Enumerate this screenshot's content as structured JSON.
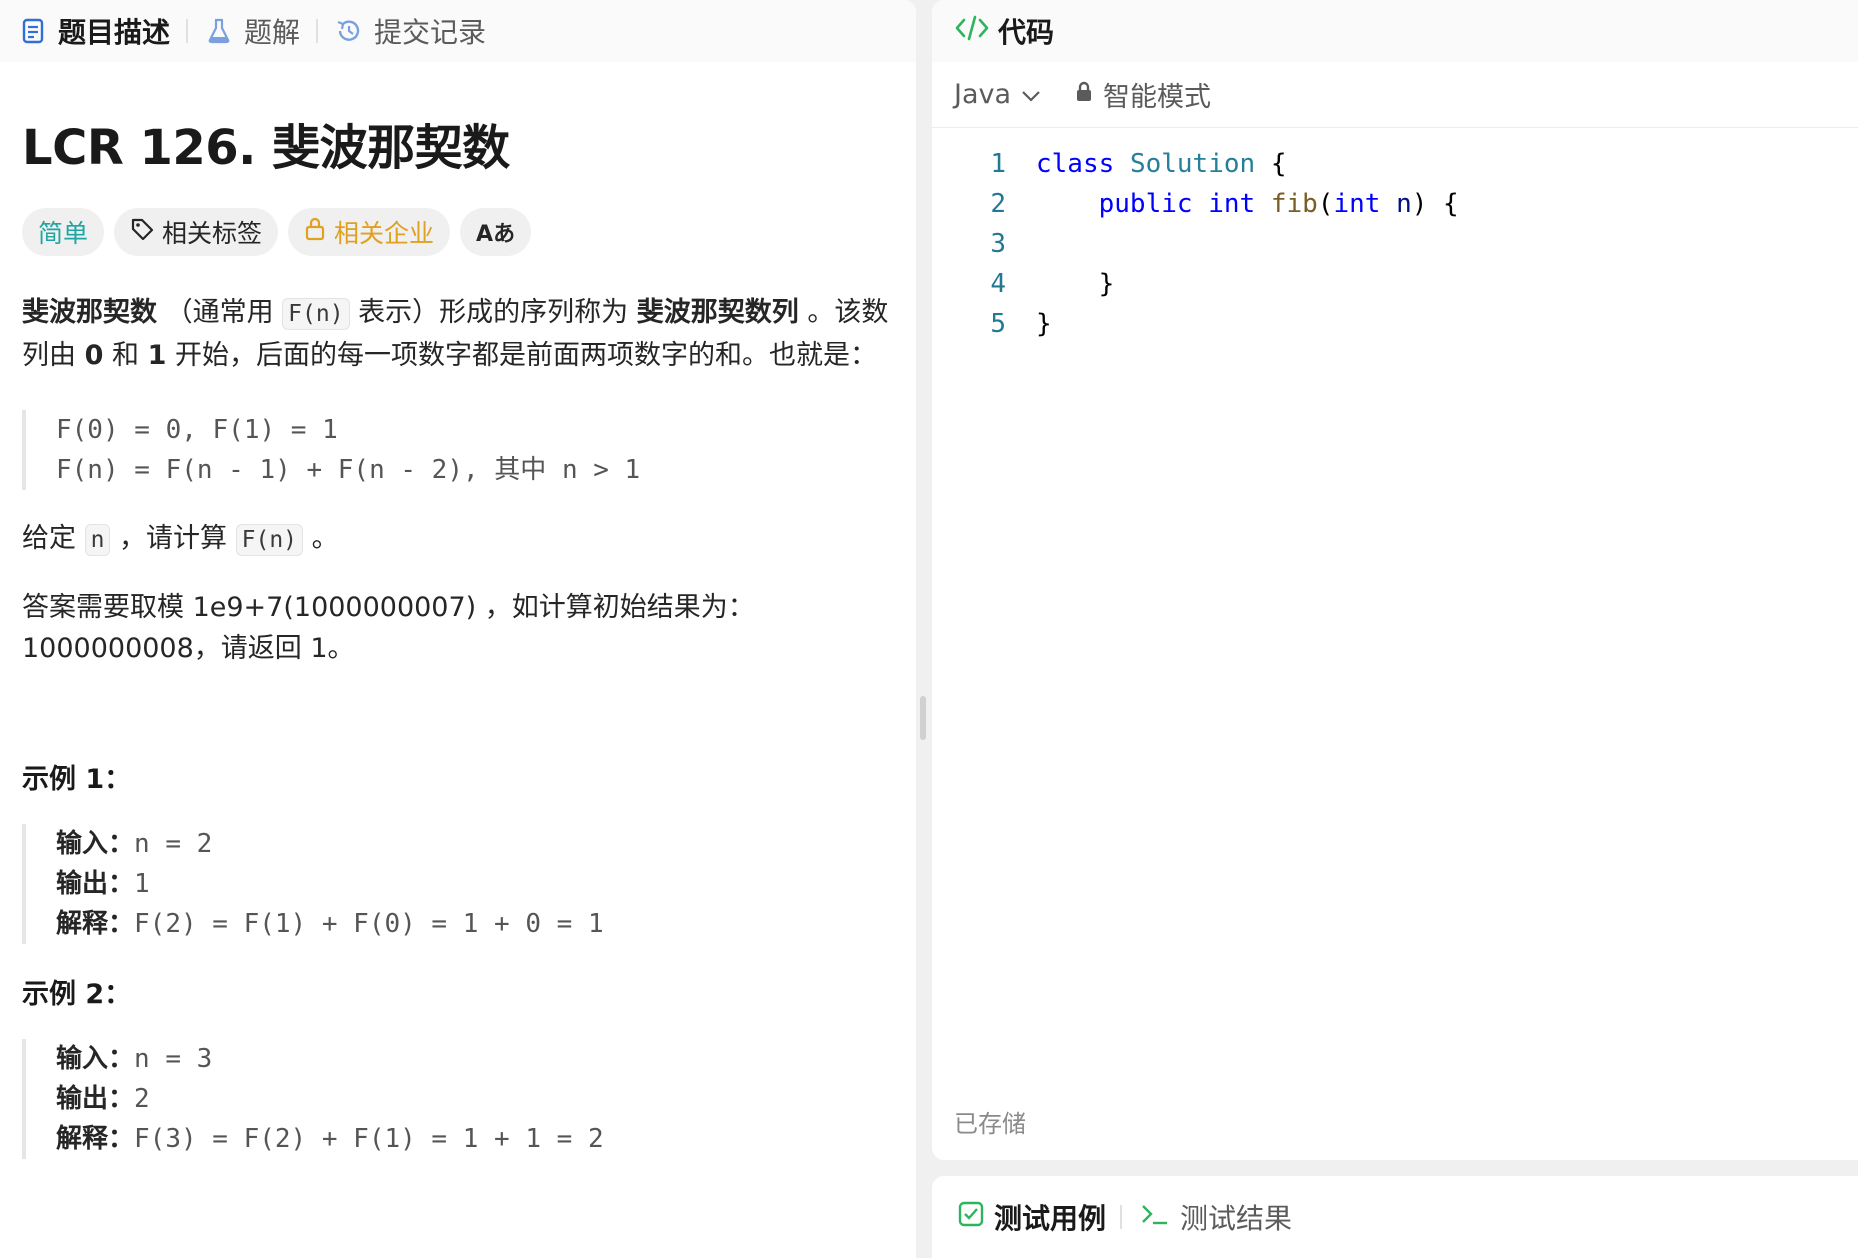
{
  "left_tabs": [
    {
      "label": "题目描述",
      "icon": "description-icon",
      "active": true
    },
    {
      "label": "题解",
      "icon": "flask-icon",
      "active": false
    },
    {
      "label": "提交记录",
      "icon": "history-icon",
      "active": false
    }
  ],
  "problem": {
    "title": "LCR 126. 斐波那契数",
    "tags": {
      "difficulty": "简单",
      "related_tags": "相关标签",
      "related_companies": "相关企业",
      "translate_icon": "Aあ"
    },
    "desc": {
      "b1": "斐波那契数",
      "t1": " （通常用 ",
      "c1": "F(n)",
      "t2": " 表示）形成的序列称为 ",
      "b2": "斐波那契数列",
      "t3": " 。该数列由 ",
      "b3": "0",
      "t4": " 和 ",
      "b4": "1",
      "t5": " 开始，后面的每一项数字都是前面两项数字的和。也就是："
    },
    "formula": [
      "F(0) = 0, F(1) = 1",
      "F(n) = F(n - 1) + F(n - 2), 其中 n > 1"
    ],
    "given": {
      "t1": "给定 ",
      "c1": "n",
      "t2": " ，请计算 ",
      "c2": "F(n)",
      "t3": " 。"
    },
    "mod_text": "答案需要取模 1e9+7(1000000007) ，如计算初始结果为：1000000008，请返回 1。",
    "examples": [
      {
        "title": "示例 1：",
        "input_label": "输入：",
        "input": "n = 2",
        "output_label": "输出：",
        "output": "1",
        "expl_label": "解释：",
        "expl": "F(2) = F(1) + F(0) = 1 + 0 = 1"
      },
      {
        "title": "示例 2：",
        "input_label": "输入：",
        "input": "n = 3",
        "output_label": "输出：",
        "output": "2",
        "expl_label": "解释：",
        "expl": "F(3) = F(2) + F(1) = 1 + 1 = 2"
      }
    ]
  },
  "code_panel": {
    "title": "代码",
    "language": "Java",
    "mode": "智能模式",
    "saved_label": "已存储",
    "line_numbers": [
      "1",
      "2",
      "3",
      "4",
      "5"
    ]
  },
  "bottom_tabs": {
    "test_cases": "测试用例",
    "test_results": "测试结果"
  },
  "colors": {
    "easy": "#1fa6a3",
    "company": "#e0a020",
    "keyword": "#0000ff",
    "type": "#267f99",
    "function": "#795e26"
  }
}
